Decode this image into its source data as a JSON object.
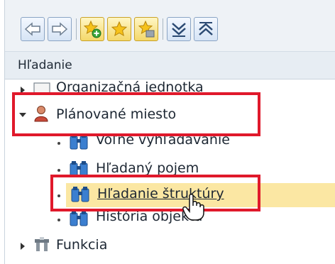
{
  "toolbar": {
    "buttons": [
      {
        "name": "back-button",
        "icon": "arrow-left-icon"
      },
      {
        "name": "forward-button",
        "icon": "arrow-right-icon"
      },
      {
        "name": "add-favorite-button",
        "icon": "star-add-icon"
      },
      {
        "name": "favorites-button",
        "icon": "star-icon"
      },
      {
        "name": "manage-favorites-button",
        "icon": "star-folder-icon"
      },
      {
        "name": "expand-button",
        "icon": "chevron-double-down-icon"
      },
      {
        "name": "collapse-button",
        "icon": "chevron-double-up-icon"
      }
    ]
  },
  "panel": {
    "header": "Hľadanie"
  },
  "tree": {
    "org_unit": "Organizačná jednotka",
    "position": "Plánované miesto",
    "children": [
      "Voľné vyhľadávanie",
      "Hľadaný pojem",
      "Hľadanie štruktúry",
      "História objektu"
    ],
    "function": "Funkcia"
  },
  "colors": {
    "highlight": "#fbe7a3",
    "annotation": "#e0192b"
  }
}
